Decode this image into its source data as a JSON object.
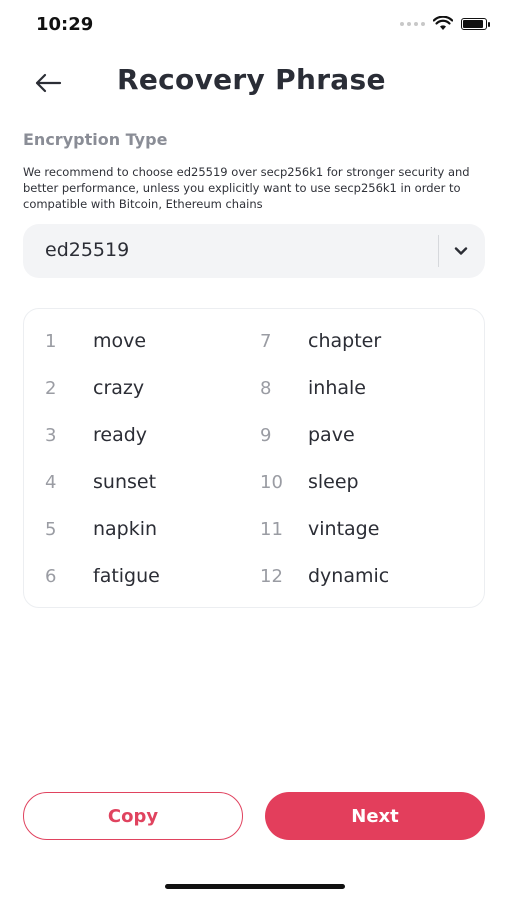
{
  "status_bar": {
    "time": "10:29",
    "icons": [
      "signal-icon",
      "wifi-icon",
      "battery-icon"
    ]
  },
  "header": {
    "back_icon": "arrow-left-icon",
    "title": "Recovery Phrase"
  },
  "encryption": {
    "label": "Encryption Type",
    "description": "We recommend to choose ed25519 over secp256k1 for stronger security and better performance, unless you explicitly want to use secp256k1 in order to compatible with Bitcoin, Ethereum chains",
    "selected": "ed25519",
    "chevron_icon": "chevron-down-icon"
  },
  "phrase": {
    "words": [
      {
        "num": "1",
        "word": "move"
      },
      {
        "num": "2",
        "word": "crazy"
      },
      {
        "num": "3",
        "word": "ready"
      },
      {
        "num": "4",
        "word": "sunset"
      },
      {
        "num": "5",
        "word": "napkin"
      },
      {
        "num": "6",
        "word": "fatigue"
      },
      {
        "num": "7",
        "word": "chapter"
      },
      {
        "num": "8",
        "word": "inhale"
      },
      {
        "num": "9",
        "word": "pave"
      },
      {
        "num": "10",
        "word": "sleep"
      },
      {
        "num": "11",
        "word": "vintage"
      },
      {
        "num": "12",
        "word": "dynamic"
      }
    ]
  },
  "actions": {
    "copy_label": "Copy",
    "next_label": "Next"
  },
  "colors": {
    "accent": "#e33e5c",
    "title": "#2a2d36",
    "muted": "#8a8d96",
    "field_bg": "#f3f4f6"
  }
}
